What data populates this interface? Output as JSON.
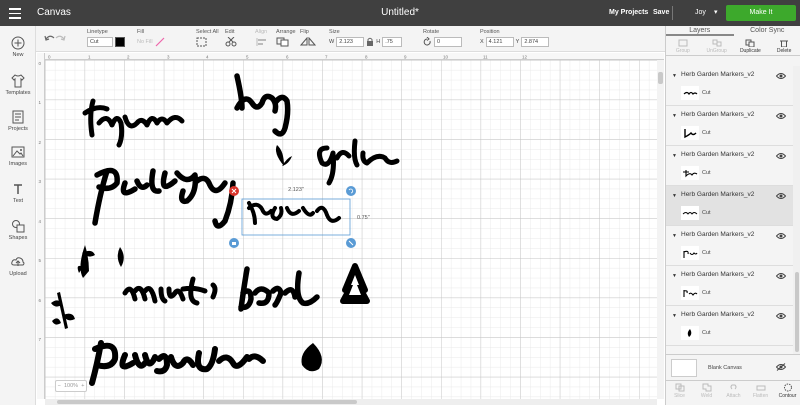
{
  "topbar": {
    "app_title": "Canvas",
    "doc_title": "Untitled*",
    "my_projects": "My Projects",
    "save": "Save",
    "user": "Joy",
    "make_it": "Make It"
  },
  "toolbar": {
    "linetype_label": "Linetype",
    "linetype_value": "Cut",
    "fill_label": "Fill",
    "fill_value": "No Fill",
    "select_all_label": "Select All",
    "edit_label": "Edit",
    "align_label": "Align",
    "arrange_label": "Arrange",
    "flip_label": "Flip",
    "size_label": "Size",
    "size_w_label": "W",
    "size_w": "2.123",
    "size_h_label": "H",
    "size_h": ".75",
    "rotate_label": "Rotate",
    "rotate_value": "0",
    "position_label": "Position",
    "pos_x_label": "X",
    "pos_x": "4.121",
    "pos_y_label": "Y",
    "pos_y": "2.874"
  },
  "sidebar": {
    "items": [
      {
        "label": "New",
        "icon": "plus-icon"
      },
      {
        "label": "Templates",
        "icon": "shirt-icon"
      },
      {
        "label": "Projects",
        "icon": "projects-icon"
      },
      {
        "label": "Images",
        "icon": "image-icon"
      },
      {
        "label": "Text",
        "icon": "text-icon"
      },
      {
        "label": "Shapes",
        "icon": "shapes-icon"
      },
      {
        "label": "Upload",
        "icon": "upload-icon"
      }
    ]
  },
  "canvas": {
    "words": [
      "bay",
      "thyme",
      "garlic",
      "parsley",
      "rosemary",
      "mint",
      "basil",
      "lavender"
    ],
    "selection_width": "2.123\"",
    "selection_height": "0.75\"",
    "ruler_h": [
      "0",
      "1",
      "2",
      "3",
      "4",
      "5",
      "6",
      "7",
      "8",
      "9",
      "10",
      "11",
      "12"
    ],
    "ruler_v": [
      "0",
      "1",
      "2",
      "3",
      "4",
      "5",
      "6",
      "7"
    ],
    "zoom": "100%"
  },
  "layers_panel": {
    "tabs": [
      "Layers",
      "Color Sync"
    ],
    "actions": [
      "Group",
      "UnGroup",
      "Duplicate",
      "Delete"
    ],
    "layers": [
      {
        "name": "Herb Garden Markers_v2",
        "type": "Cut",
        "thumb": "garlic",
        "selected": false
      },
      {
        "name": "Herb Garden Markers_v2",
        "type": "Cut",
        "thumb": "basil",
        "selected": false
      },
      {
        "name": "Herb Garden Markers_v2",
        "type": "Cut",
        "thumb": "thyme",
        "selected": false
      },
      {
        "name": "Herb Garden Markers_v2",
        "type": "Cut",
        "thumb": "rosemary",
        "selected": true
      },
      {
        "name": "Herb Garden Markers_v2",
        "type": "Cut",
        "thumb": "parsley",
        "selected": false
      },
      {
        "name": "Herb Garden Markers_v2",
        "type": "Cut",
        "thumb": "lavender",
        "selected": false
      },
      {
        "name": "Herb Garden Markers_v2",
        "type": "Cut",
        "thumb": "leaf",
        "selected": false
      }
    ],
    "blank_canvas": "Blank Canvas",
    "bottom_actions": [
      "Slice",
      "Weld",
      "Attach",
      "Flatten",
      "Contour"
    ]
  },
  "colors": {
    "topbar": "#404040",
    "make_it": "#3da92c",
    "selection": "#5a9bd5",
    "delete_handle": "#d9342b"
  }
}
